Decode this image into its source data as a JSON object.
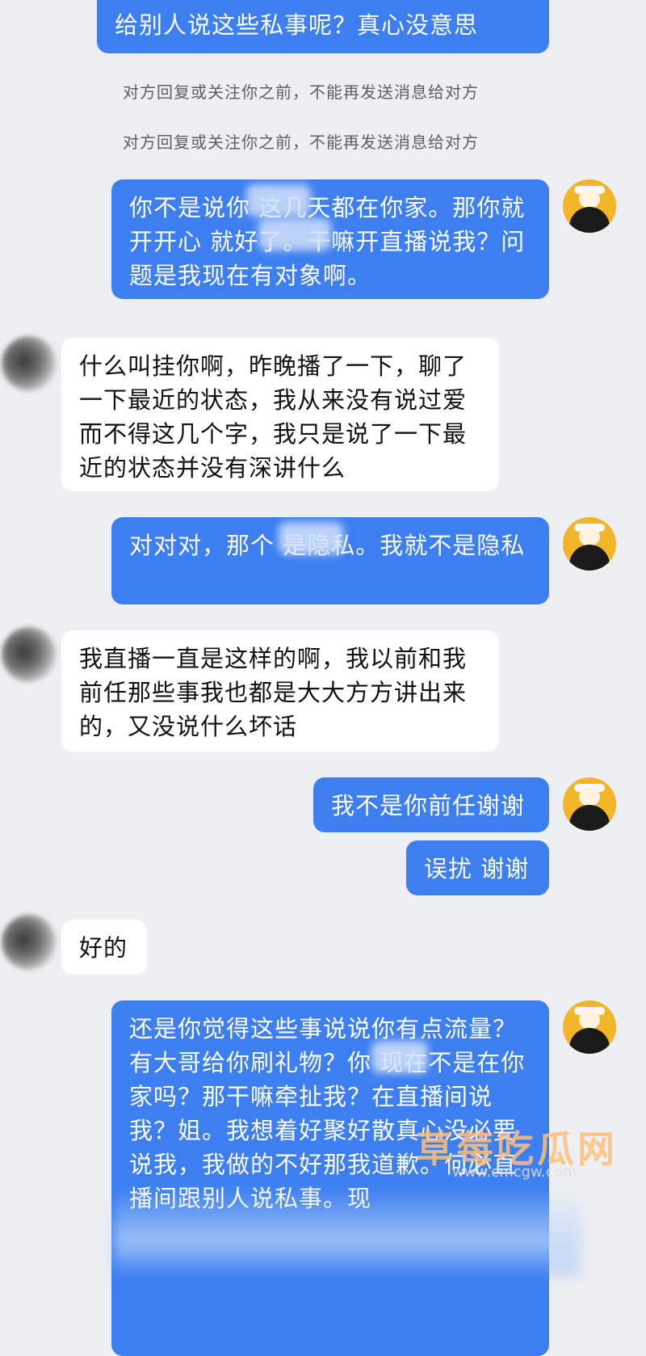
{
  "messages": {
    "m0": "给别人说这些私事呢？真心没意思",
    "sys1": "对方回复或关注你之前，不能再发送消息给对方",
    "sys2": "对方回复或关注你之前，不能再发送消息给对方",
    "m1": "你不是说你  这几天都在你家。那你就开开心  就好了。干嘛开直播说我？问题是我现在有对象啊。",
    "m2": "什么叫挂你啊，昨晚播了一下，聊了一下最近的状态，我从来没有说过爱而不得这几个字，我只是说了一下最近的状态并没有深讲什么",
    "m3": "对对对，那个  是隐私。我就不是隐私",
    "m4": "我直播一直是这样的啊，我以前和我前任那些事我也都是大大方方讲出来的，又没说什么坏话",
    "m5": "我不是你前任谢谢",
    "m6": "误扰 谢谢",
    "m7": "好的",
    "m8": "还是你觉得这些事说说你有点流量？有大哥给你刷礼物？你  现在不是在你家吗？那干嘛牵扯我？在直播间说我？姐。我想着好聚好散真心没必要说我，我做的不好那我道歉。何必直播间跟别人说私事。现"
  },
  "watermark": {
    "brand": "草莓吃瓜网",
    "url": "www.cmcgw.com"
  },
  "colors": {
    "outgoing": "#3d7ff0",
    "incoming": "#ffffff",
    "background": "#eeeff2"
  }
}
